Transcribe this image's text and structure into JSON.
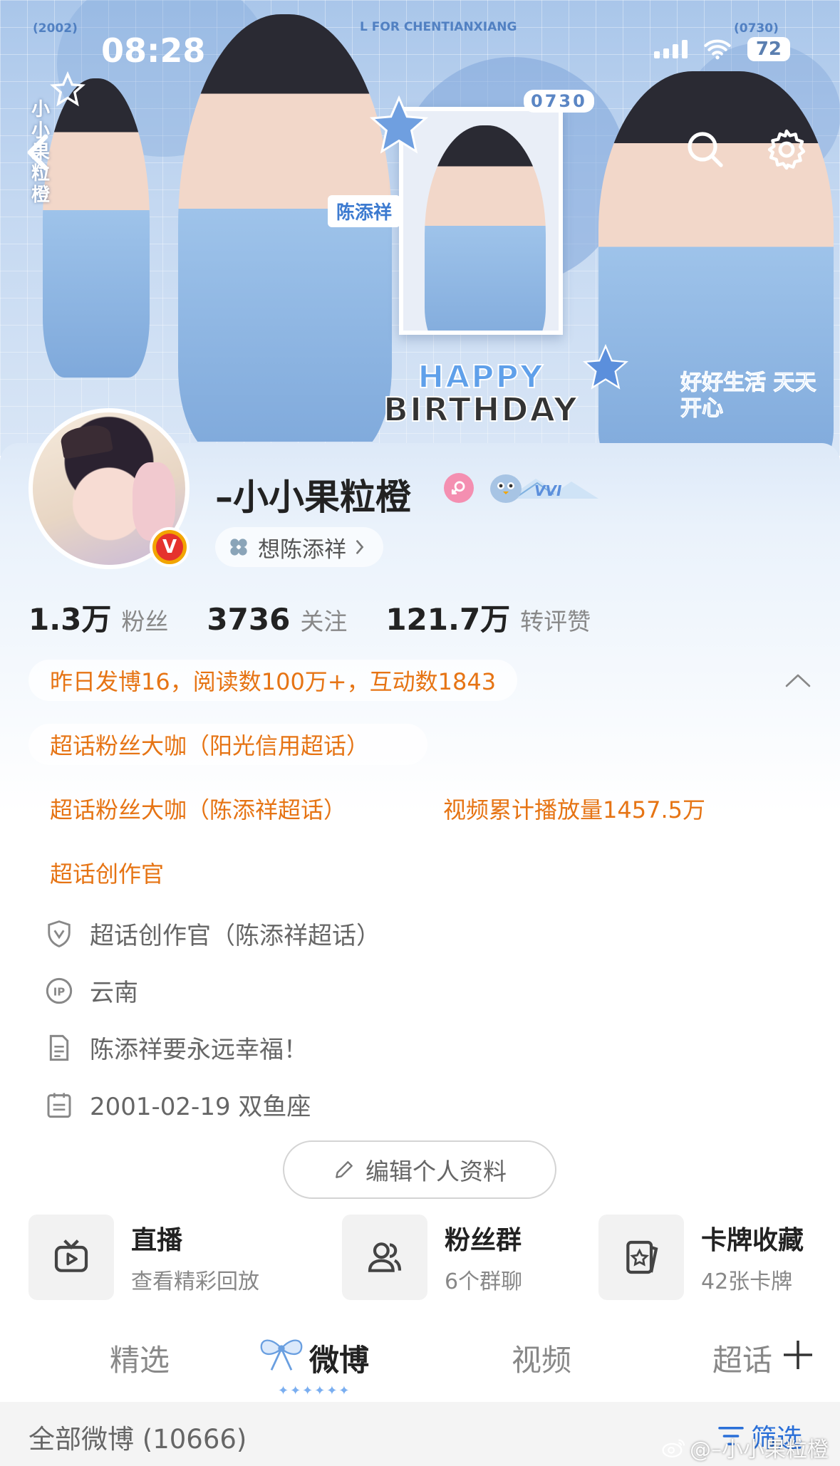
{
  "status_bar": {
    "time": "08:28",
    "battery": "72"
  },
  "banner": {
    "top_left_text": "(2002)",
    "top_center_text": "L FOR CHENTIANXIANG",
    "top_right_text": "(0730)",
    "date_badge": "0730",
    "name_tag": "陈添祥",
    "happy": "HAPPY",
    "birthday": "BIRTHDAY",
    "slogan": "好好生活  天天开心",
    "vertical_name": "小小果粒橙"
  },
  "profile": {
    "username": "–小小果粒橙",
    "level_badge": "VVI",
    "chip_label": "想陈添祥",
    "stats": [
      {
        "num": "1.3万",
        "label": "粉丝"
      },
      {
        "num": "3736",
        "label": "关注"
      },
      {
        "num": "121.7万",
        "label": "转评赞"
      }
    ],
    "activity": "昨日发博16，阅读数100万+，互动数1843",
    "honors": [
      "超话粉丝大咖（阳光信用超话）",
      "超话粉丝大咖（陈添祥超话）",
      "视频累计播放量1457.5万",
      "超话创作官"
    ],
    "info": [
      {
        "icon": "shield-v-icon",
        "text": "超话创作官（陈添祥超话）"
      },
      {
        "icon": "ip-icon",
        "text": "云南"
      },
      {
        "icon": "document-icon",
        "text": "陈添祥要永远幸福！"
      },
      {
        "icon": "calendar-icon",
        "text": "2001-02-19 双鱼座"
      }
    ],
    "edit_button": "编辑个人资料"
  },
  "tiles": [
    {
      "title": "直播",
      "sub": "查看精彩回放",
      "icon": "live-tv-icon"
    },
    {
      "title": "粉丝群",
      "sub": "6个群聊",
      "icon": "group-icon"
    },
    {
      "title": "卡牌收藏",
      "sub": "42张卡牌",
      "icon": "card-icon"
    }
  ],
  "tabs": [
    "精选",
    "微博",
    "视频",
    "超话"
  ],
  "active_tab": "微博",
  "tab_decoration": "✦✦✦✦✦✦",
  "filter_bar": {
    "count": "全部微博 (10666)",
    "filter": "筛选"
  },
  "watermark": "@–小小果粒橙",
  "colors": {
    "accent_orange": "#e67414",
    "link_blue": "#2a6fd8",
    "banner_blue": "#a9c6ea"
  }
}
